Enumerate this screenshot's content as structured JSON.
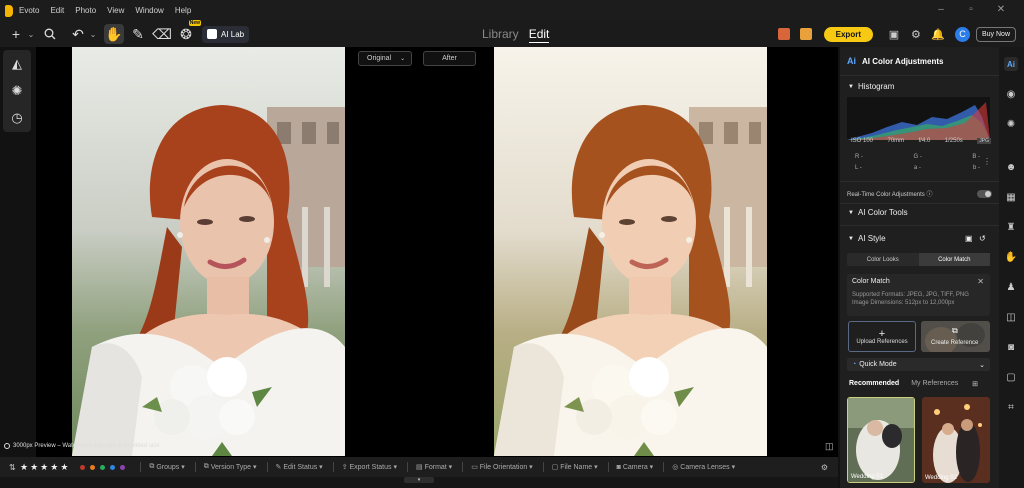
{
  "app": {
    "menu": [
      "Evoto",
      "Edit",
      "Photo",
      "View",
      "Window",
      "Help"
    ]
  },
  "toolbar": {
    "new_badge": "New",
    "ai_lab_label": "AI Lab",
    "view_tabs": [
      "Library",
      "Edit"
    ],
    "active_view": "Edit",
    "export_label": "Export",
    "avatar_initial": "C",
    "buy_now_label": "Buy Now"
  },
  "canvas": {
    "compare_mode": "Original",
    "after_label": "After",
    "preview_note": "3000px Preview – Watermark adjusted to provided size"
  },
  "filter_bar": {
    "rating_stars": 5,
    "color_labels": [
      "#c0392b",
      "#e67e22",
      "#27ae60",
      "#2e86de",
      "#8e44ad"
    ],
    "filters": [
      "Groups",
      "Version Type",
      "Edit Status",
      "Export Status",
      "Format",
      "File Orientation",
      "File Name",
      "Camera",
      "Camera Lenses"
    ]
  },
  "panel": {
    "header_title": "AI Color Adjustments",
    "histogram_title": "Histogram",
    "exif": {
      "iso": "ISO 100",
      "focal": "70mm",
      "aperture": "f/4.0",
      "shutter": "1/250s",
      "format": "JPG"
    },
    "rgb_row1": [
      "R -",
      "G -",
      "B -"
    ],
    "rgb_row2": [
      "L -",
      "a -",
      "b -"
    ],
    "realtime_label": "Real-Time Color Adjustments ⓘ",
    "color_tools_title": "AI Color Tools",
    "ai_style_title": "AI Style",
    "style_tabs": [
      "Color Looks",
      "Color Match"
    ],
    "active_style_tab": "Color Match",
    "color_match": {
      "title": "Color Match",
      "formats": "Supported Formats: JPEG, JPG, TIFF, PNG",
      "dimensions": "Image Dimensions: 512px to 12,000px"
    },
    "upload_label": "Upload References",
    "create_label": "Create Reference",
    "quick_mode_label": "Quick Mode",
    "rec_tabs": [
      "Recommended",
      "My References"
    ],
    "thumbs": [
      "Wedding 01",
      "Wedding 02"
    ]
  }
}
